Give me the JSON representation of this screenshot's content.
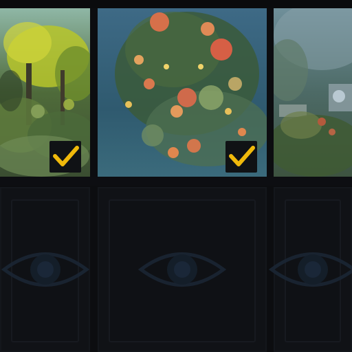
{
  "gallery": {
    "unlocked_items": [
      {
        "name": "forest-painting",
        "selected": true
      },
      {
        "name": "flower-bush-painting",
        "selected": true
      },
      {
        "name": "village-painting",
        "selected": false
      }
    ],
    "locked_items": [
      {
        "state": "locked",
        "icon": "eye-icon"
      },
      {
        "state": "locked",
        "icon": "eye-icon"
      },
      {
        "state": "locked",
        "icon": "eye-icon"
      }
    ]
  },
  "colors": {
    "background": "#0c0d10",
    "check_accent": "#f0b90b",
    "eye_icon": "#1c2a3c"
  }
}
